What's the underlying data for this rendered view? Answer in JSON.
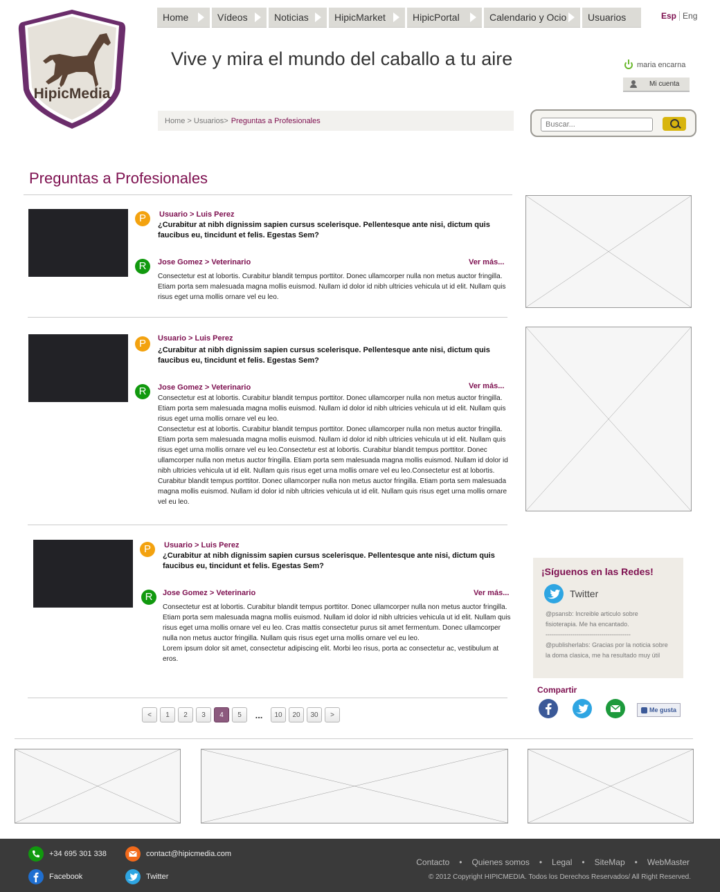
{
  "logo": {
    "text": "HipicMedia"
  },
  "nav": {
    "items": [
      "Home",
      "Vídeos",
      "Noticias",
      "HipicMarket",
      "HipicPortal",
      "Calendario y Ocio",
      "Usuarios"
    ]
  },
  "lang": {
    "active": "Esp",
    "other": "Eng"
  },
  "tagline": "Vive y mira el mundo del caballo a tu aire",
  "user": {
    "name": "maria encarna",
    "account_label": "Mi cuenta"
  },
  "breadcrumb": {
    "path": "Home > Usuarios>",
    "current": "Preguntas a Profesionales"
  },
  "search": {
    "placeholder": "Buscar..."
  },
  "page_title": "Preguntas a Profesionales",
  "questions": [
    {
      "asker": "Usuario > Luis Perez",
      "question": "¿Curabitur at nibh dignissim sapien cursus scelerisque. Pellentesque ante nisi, dictum quis faucibus eu, tincidunt et felis. Egestas Sem?",
      "answerer": "Jose Gomez > Veterinario",
      "more": "Ver más...",
      "answer": "Consectetur est at lobortis. Curabitur blandit tempus porttitor. Donec ullamcorper nulla non metus auctor fringilla. Etiam porta sem malesuada magna mollis euismod. Nullam id dolor id nibh ultricies vehicula ut id elit. Nullam quis risus eget urna mollis ornare vel eu leo."
    },
    {
      "asker": "Usuario > Luis Perez",
      "question": "¿Curabitur at nibh dignissim sapien cursus scelerisque. Pellentesque ante nisi, dictum quis faucibus eu, tincidunt et felis. Egestas Sem?",
      "answerer": "Jose Gomez > Veterinario",
      "more": "Ver más...",
      "answer": "Consectetur est at lobortis. Curabitur blandit tempus porttitor. Donec ullamcorper nulla non metus auctor fringilla. Etiam porta sem malesuada magna mollis euismod. Nullam id dolor id nibh ultricies vehicula ut id elit. Nullam quis risus eget urna mollis ornare vel eu leo.\nConsectetur est at lobortis. Curabitur blandit tempus porttitor. Donec ullamcorper nulla non metus auctor fringilla. Etiam porta sem malesuada magna mollis euismod. Nullam id dolor id nibh ultricies vehicula ut id elit. Nullam quis risus eget urna mollis ornare vel eu leo.Consectetur est at lobortis. Curabitur blandit tempus porttitor. Donec ullamcorper nulla non metus auctor fringilla. Etiam porta sem malesuada magna mollis euismod. Nullam id dolor id nibh ultricies vehicula ut id elit. Nullam quis risus eget urna mollis ornare vel eu leo.Consectetur est at lobortis. Curabitur blandit tempus porttitor. Donec ullamcorper nulla non metus auctor fringilla. Etiam porta sem malesuada magna mollis euismod. Nullam id dolor id nibh ultricies vehicula ut id elit. Nullam quis risus eget urna mollis ornare vel eu leo."
    },
    {
      "asker": "Usuario > Luis Perez",
      "question": "¿Curabitur at nibh dignissim sapien cursus scelerisque. Pellentesque ante nisi, dictum quis faucibus eu, tincidunt et felis. Egestas Sem?",
      "answerer": "Jose Gomez > Veterinario",
      "more": "Ver más...",
      "answer": "Consectetur est at lobortis. Curabitur blandit tempus porttitor. Donec ullamcorper nulla non metus auctor fringilla. Etiam porta sem malesuada magna mollis euismod. Nullam id dolor id nibh ultricies vehicula ut id elit. Nullam quis risus eget urna mollis ornare vel eu leo. Cras mattis consectetur purus sit amet fermentum. Donec ullamcorper nulla non metus auctor fringilla. Nullam quis risus eget urna mollis ornare vel eu leo.\nLorem ipsum dolor sit amet, consectetur adipiscing elit. Morbi leo risus, porta ac consectetur ac, vestibulum at eros."
    }
  ],
  "badges": {
    "question": "P",
    "answer": "R"
  },
  "pagination": {
    "prev": "<",
    "next": ">",
    "pages": [
      "1",
      "2",
      "3",
      "4",
      "5",
      "...",
      "10",
      "20",
      "30"
    ],
    "active": "4"
  },
  "social": {
    "title": "¡Síguenos en las Redes!",
    "twitter_label": "Twitter",
    "tweets": [
      "@psansb: Increible articulo sobre fisioterapia. Me ha encantado.",
      "@publisherlabs: Gracias por la noticia sobre la doma clasica, me ha resultado muy útil"
    ],
    "separator": "-----------------------------------------"
  },
  "share": {
    "title": "Compartir",
    "like_label": "Me gusta"
  },
  "footer": {
    "phone": "+34 695 301 338",
    "email": "contact@hipicmedia.com",
    "facebook": "Facebook",
    "twitter": "Twitter",
    "links": [
      "Contacto",
      "Quienes somos",
      "Legal",
      "SiteMap",
      "WebMaster"
    ],
    "bullet": "•",
    "copyright": "© 2012 Copyright HIPICMEDIA. Todos los Derechos Reservados/ All Right Reserved."
  },
  "colors": {
    "brand": "#7d0f4f",
    "question_badge": "#f3a20f",
    "answer_badge": "#11990e",
    "footer_bg": "#3a3a3a"
  }
}
